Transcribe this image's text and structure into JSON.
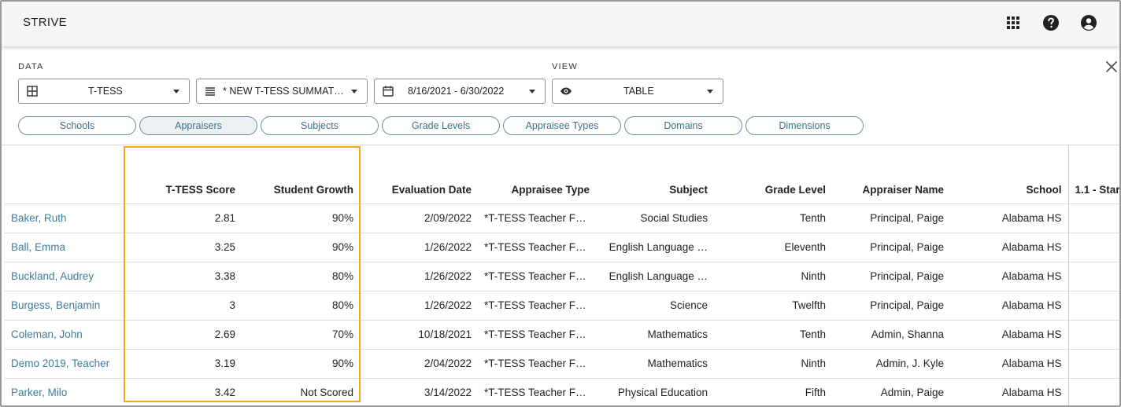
{
  "app": {
    "title": "STRIVE"
  },
  "header_icons": {
    "apps": "grid-apps-icon",
    "help": "help-circle-icon",
    "account": "account-circle-icon"
  },
  "filters": {
    "data_label": "DATA",
    "view_label": "VIEW",
    "data_source": "T-TESS",
    "form": "* NEW T-TESS SUMMAT…",
    "date_range": "8/16/2021 - 6/30/2022",
    "view": "TABLE"
  },
  "chips": [
    "Schools",
    "Appraisers",
    "Subjects",
    "Grade Levels",
    "Appraisee Types",
    "Domains",
    "Dimensions"
  ],
  "table": {
    "columns": [
      "",
      "T-TESS Score",
      "Student Growth",
      "Evaluation Date",
      "Appraisee Type",
      "Subject",
      "Grade Level",
      "Appraiser Name",
      "School",
      "1.1 - Star"
    ],
    "rows": [
      {
        "name": "Baker, Ruth",
        "score": "2.81",
        "growth": "90%",
        "date": "2/09/2022",
        "type": "*T-TESS Teacher Fu…",
        "subject": "Social Studies",
        "grade": "Tenth",
        "appraiser": "Principal, Paige",
        "school": "Alabama HS"
      },
      {
        "name": "Ball, Emma",
        "score": "3.25",
        "growth": "90%",
        "date": "1/26/2022",
        "type": "*T-TESS Teacher Fu…",
        "subject": "English Language …",
        "grade": "Eleventh",
        "appraiser": "Principal, Paige",
        "school": "Alabama HS"
      },
      {
        "name": "Buckland, Audrey",
        "score": "3.38",
        "growth": "80%",
        "date": "1/26/2022",
        "type": "*T-TESS Teacher Fu…",
        "subject": "English Language …",
        "grade": "Ninth",
        "appraiser": "Principal, Paige",
        "school": "Alabama HS"
      },
      {
        "name": "Burgess, Benjamin",
        "score": "3",
        "growth": "80%",
        "date": "1/26/2022",
        "type": "*T-TESS Teacher Fu…",
        "subject": "Science",
        "grade": "Twelfth",
        "appraiser": "Principal, Paige",
        "school": "Alabama HS"
      },
      {
        "name": "Coleman, John",
        "score": "2.69",
        "growth": "70%",
        "date": "10/18/2021",
        "type": "*T-TESS Teacher Fu…",
        "subject": "Mathematics",
        "grade": "Tenth",
        "appraiser": "Admin, Shanna",
        "school": "Alabama HS"
      },
      {
        "name": "Demo 2019, Teacher",
        "score": "3.19",
        "growth": "90%",
        "date": "2/04/2022",
        "type": "*T-TESS Teacher Fu…",
        "subject": "Mathematics",
        "grade": "Ninth",
        "appraiser": "Admin, J. Kyle",
        "school": "Alabama HS"
      },
      {
        "name": "Parker, Milo",
        "score": "3.42",
        "growth": "Not Scored",
        "date": "3/14/2022",
        "type": "*T-TESS Teacher Fu…",
        "subject": "Physical Education",
        "grade": "Fifth",
        "appraiser": "Admin, Paige",
        "school": "Alabama HS"
      }
    ]
  },
  "colors": {
    "accent_link": "#3f7c9a",
    "highlight": "#f2a81d",
    "chip_border": "#6e8fa1"
  }
}
